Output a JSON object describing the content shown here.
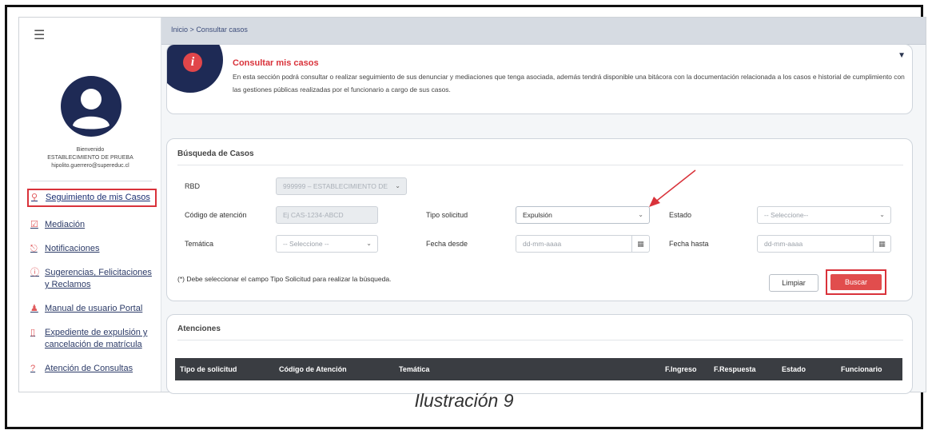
{
  "breadcrumb": {
    "home": "Inicio",
    "separator": ">",
    "current": "Consultar casos"
  },
  "sidebar": {
    "welcome": "Bienvenido",
    "establishment": "ESTABLECIMIENTO DE PRUEBA",
    "email": "hipolito.guerrero@supereduc.cl",
    "items": [
      {
        "label": "Seguimiento de mis Casos",
        "icon": "search-icon"
      },
      {
        "label": "Mediación",
        "icon": "checkbox-icon"
      },
      {
        "label": "Notificaciones",
        "icon": "bell-icon"
      },
      {
        "label": "Sugerencias, Felicitaciones y Reclamos",
        "icon": "question-icon"
      },
      {
        "label": "Manual de usuario Portal",
        "icon": "users-icon"
      },
      {
        "label": "Expediente de expulsión y cancelación de matrícula",
        "icon": "trash-icon"
      },
      {
        "label": "Atención de Consultas",
        "icon": "question-icon"
      }
    ]
  },
  "info": {
    "title": "Consultar mis casos",
    "text": "En esta sección podrá consultar o realizar seguimiento de sus denunciar y mediaciones que tenga asociada, además tendrá disponible una bitácora con la documentación relacionada a los casos e historial de cumplimiento con las gestiones públicas realizadas por el funcionario a cargo de sus casos.",
    "toggle_icon": "triangle-down-icon"
  },
  "search": {
    "title": "Búsqueda de Casos",
    "rbd_label": "RBD",
    "rbd_value": "999999 – ESTABLECIMIENTO DE",
    "code_label": "Código de atención",
    "code_placeholder": "Ej CAS-1234-ABCD",
    "type_label": "Tipo solicitud",
    "type_value": "Expulsión",
    "state_label": "Estado",
    "state_value": "-- Seleccione--",
    "theme_label": "Temática",
    "theme_value": "-- Seleccione --",
    "from_label": "Fecha desde",
    "from_placeholder": "dd-mm-aaaa",
    "to_label": "Fecha hasta",
    "to_placeholder": "dd-mm-aaaa",
    "note": "(*) Debe seleccionar el campo Tipo Solicitud para realizar la búsqueda.",
    "clear_label": "Limpiar",
    "search_label": "Buscar"
  },
  "attentions": {
    "title": "Atenciones",
    "columns": [
      "Tipo de solicitud",
      "Código de Atención",
      "Temática",
      "F.Ingreso",
      "F.Respuesta",
      "Estado",
      "Funcionario"
    ]
  },
  "caption": "Ilustración 9",
  "colors": {
    "accent": "#d9323a",
    "navy": "#1e2a55",
    "table_header": "#3a3d42"
  }
}
